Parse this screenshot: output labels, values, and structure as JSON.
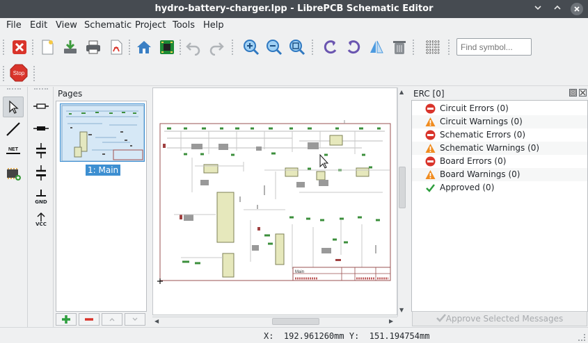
{
  "window": {
    "title": "hydro-battery-charger.lpp - LibrePCB Schematic Editor",
    "controls": [
      "chevron-down-icon",
      "chevron-up-icon",
      "close-icon"
    ]
  },
  "menu": {
    "items": [
      "File",
      "Edit",
      "View",
      "Schematic",
      "Project",
      "Tools",
      "Help"
    ]
  },
  "toolbar": {
    "search_placeholder": "Find symbol...",
    "stop_label": "Stop"
  },
  "symbol_tools": {
    "net_label": "NET",
    "gnd_label": "GND",
    "vcc_label": "VCC"
  },
  "pages": {
    "header": "Pages",
    "items": [
      {
        "label": "1: Main"
      }
    ]
  },
  "erc": {
    "header": "ERC [0]",
    "rows": [
      {
        "label": "Circuit Errors (0)",
        "icon": "error-icon"
      },
      {
        "label": "Circuit Warnings (0)",
        "icon": "warning-icon"
      },
      {
        "label": "Schematic Errors (0)",
        "icon": "error-icon"
      },
      {
        "label": "Schematic Warnings (0)",
        "icon": "warning-icon"
      },
      {
        "label": "Board Errors (0)",
        "icon": "error-icon"
      },
      {
        "label": "Board Warnings (0)",
        "icon": "warning-icon"
      },
      {
        "label": "Approved (0)",
        "icon": "check-icon"
      }
    ],
    "approve_button": "Approve Selected Messages"
  },
  "schematic": {
    "frame_title": "Main"
  },
  "status": {
    "x_label": "X:",
    "x_value": "192.961260mm",
    "y_label": "Y:",
    "y_value": "151.194754mm"
  },
  "colors": {
    "titlebar": "#464b51",
    "selection": "#3d8fd1",
    "error": "#d9342b",
    "warning": "#f08c1f",
    "ok": "#2e9e3e"
  }
}
